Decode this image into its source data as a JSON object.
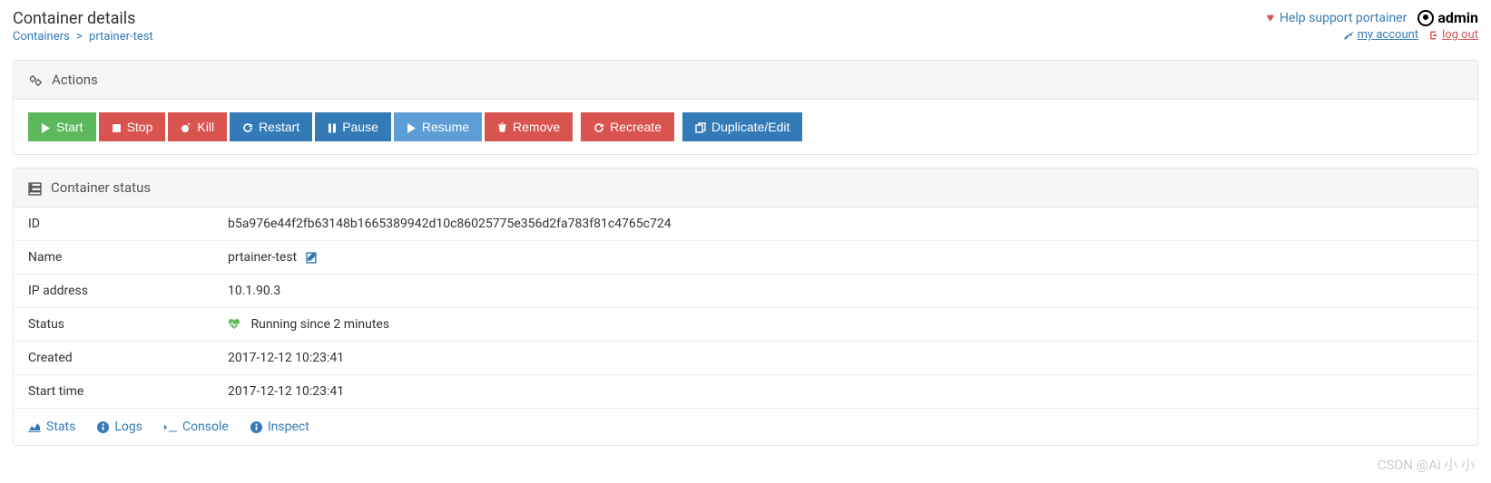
{
  "header": {
    "title": "Container details",
    "breadcrumb": {
      "parent": "Containers",
      "current": "prtainer-test"
    },
    "support_link": "Help support portainer",
    "user": "admin",
    "my_account": "my account",
    "log_out": "log out"
  },
  "actions_panel": {
    "title": "Actions",
    "buttons": {
      "start": "Start",
      "stop": "Stop",
      "kill": "Kill",
      "restart": "Restart",
      "pause": "Pause",
      "resume": "Resume",
      "remove": "Remove",
      "recreate": "Recreate",
      "duplicate": "Duplicate/Edit"
    }
  },
  "status_panel": {
    "title": "Container status",
    "rows": {
      "id_label": "ID",
      "id_value": "b5a976e44f2fb63148b1665389942d10c86025775e356d2fa783f81c4765c724",
      "name_label": "Name",
      "name_value": "prtainer-test",
      "ip_label": "IP address",
      "ip_value": "10.1.90.3",
      "status_label": "Status",
      "status_value": "Running since 2 minutes",
      "created_label": "Created",
      "created_value": "2017-12-12 10:23:41",
      "start_label": "Start time",
      "start_value": "2017-12-12 10:23:41"
    },
    "tabs": {
      "stats": "Stats",
      "logs": "Logs",
      "console": "Console",
      "inspect": "Inspect"
    }
  },
  "watermark": "CSDN @Ai 小 小"
}
